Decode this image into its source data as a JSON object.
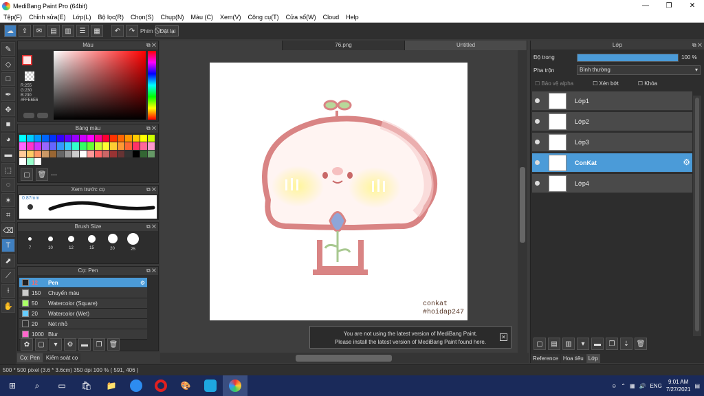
{
  "window": {
    "title": "MediBang Paint Pro (64bit)"
  },
  "menu": [
    "Tệp(F)",
    "Chỉnh sửa(E)",
    "Lớp(L)",
    "Bộ lọc(R)",
    "Chọn(S)",
    "Chụp(N)",
    "Màu (C)",
    "Xem(V)",
    "Công cụ(T)",
    "Cửa sổ(W)",
    "Cloud",
    "Help"
  ],
  "toolbar": {
    "key_label": "Phím",
    "reset_label": "Đặt lại"
  },
  "color_panel": {
    "title": "Màu",
    "r": "R:255",
    "g": "G:230",
    "b": "B:230",
    "hex": "#FFE6E6"
  },
  "palette_panel": {
    "title": "Bảng màu",
    "footer": "---"
  },
  "preview_panel": {
    "title": "Xem trước cọ",
    "size": "0.87mm"
  },
  "brushsize_panel": {
    "title": "Brush Size",
    "sizes": [
      "7",
      "10",
      "12",
      "15",
      "20",
      "25"
    ]
  },
  "brush_panel": {
    "title": "Cọ: Pen",
    "items": [
      {
        "size": "12",
        "name": "Pen",
        "color": "#222222",
        "selected": true
      },
      {
        "size": "150",
        "name": "Chuyển màu",
        "color": "#cccccc",
        "selected": false
      },
      {
        "size": "50",
        "name": "Watercolor (Square)",
        "color": "#aaff66",
        "selected": false
      },
      {
        "size": "20",
        "name": "Watercolor (Wet)",
        "color": "#66ccff",
        "selected": false
      },
      {
        "size": "20",
        "name": "Nét nhỏ",
        "color": "#333333",
        "selected": false
      },
      {
        "size": "1000",
        "name": "Blur",
        "color": "#ff66cc",
        "selected": false
      }
    ]
  },
  "left_tabs": {
    "tab1": "Cọ: Pen",
    "tab2": "Kiểm soát cọ"
  },
  "tabs": {
    "tab1": "76.png",
    "tab2": "Untitled"
  },
  "canvas": {
    "watermark1": "conkat",
    "watermark2": "#hoidap247"
  },
  "notification": {
    "line1": "You are not using the latest version of MediBang Paint.",
    "line2": "Please install the latest version of MediBang Paint found here.",
    "close": "✕"
  },
  "layer_panel": {
    "title": "Lớp",
    "opacity_label": "Độ trong",
    "opacity_value": "100 %",
    "opacity_pct": 100,
    "blend_label": "Pha trộn",
    "blend_value": "Bình thường",
    "protect_alpha": "Bảo vệ alpha",
    "clipping": "Xén bớt",
    "lock": "Khóa",
    "layers": [
      {
        "name": "Lớp1",
        "selected": false
      },
      {
        "name": "Lớp2",
        "selected": false
      },
      {
        "name": "Lớp3",
        "selected": false
      },
      {
        "name": "ConKat",
        "selected": true
      },
      {
        "name": "Lớp4",
        "selected": false
      }
    ],
    "bottom_tabs": [
      "Reference",
      "Hoa tiêu",
      "Lớp"
    ]
  },
  "status": {
    "text": "500 * 500 pixel  (3.6 * 3.6cm)  350 dpi  100 %  ( 591, 406 )"
  },
  "taskbar": {
    "lang": "ENG",
    "time": "9:01 AM",
    "date": "7/27/2021"
  }
}
